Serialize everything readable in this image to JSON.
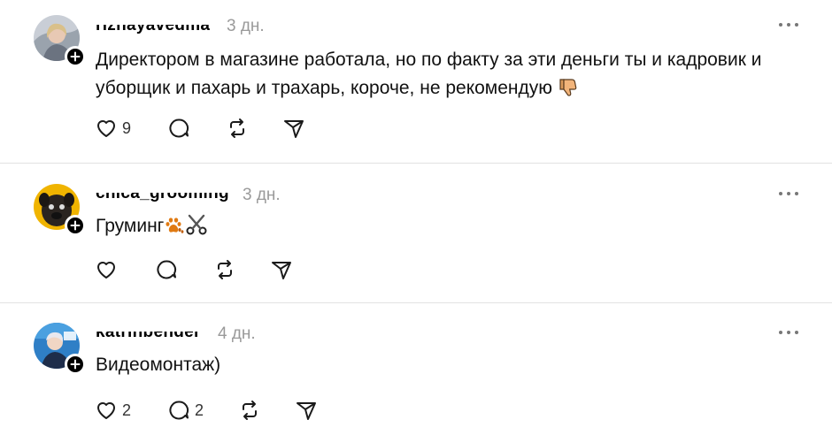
{
  "posts": [
    {
      "username": "rizhayavedma",
      "time": "3 дн.",
      "text": "Директором в магазине работала, но по факту за эти деньги ты и кадровик и уборщик и пахарь и трахарь, короче, не рекомендую",
      "emoji": "thumbs-down-icon",
      "likes": "9",
      "replies": ""
    },
    {
      "username": "chica_grooming",
      "time": "3 дн.",
      "text": "Груминг",
      "emoji": "paw-scissors-icon",
      "likes": "",
      "replies": ""
    },
    {
      "username": "katrinbender",
      "time": "4 дн.",
      "text": "Видеомонтаж)",
      "likes": "2",
      "replies": "2"
    }
  ],
  "colors": {
    "text": "#111111",
    "muted": "#9a9a9a",
    "divider": "#e2e2e2",
    "icon": "#1a1a1a"
  }
}
